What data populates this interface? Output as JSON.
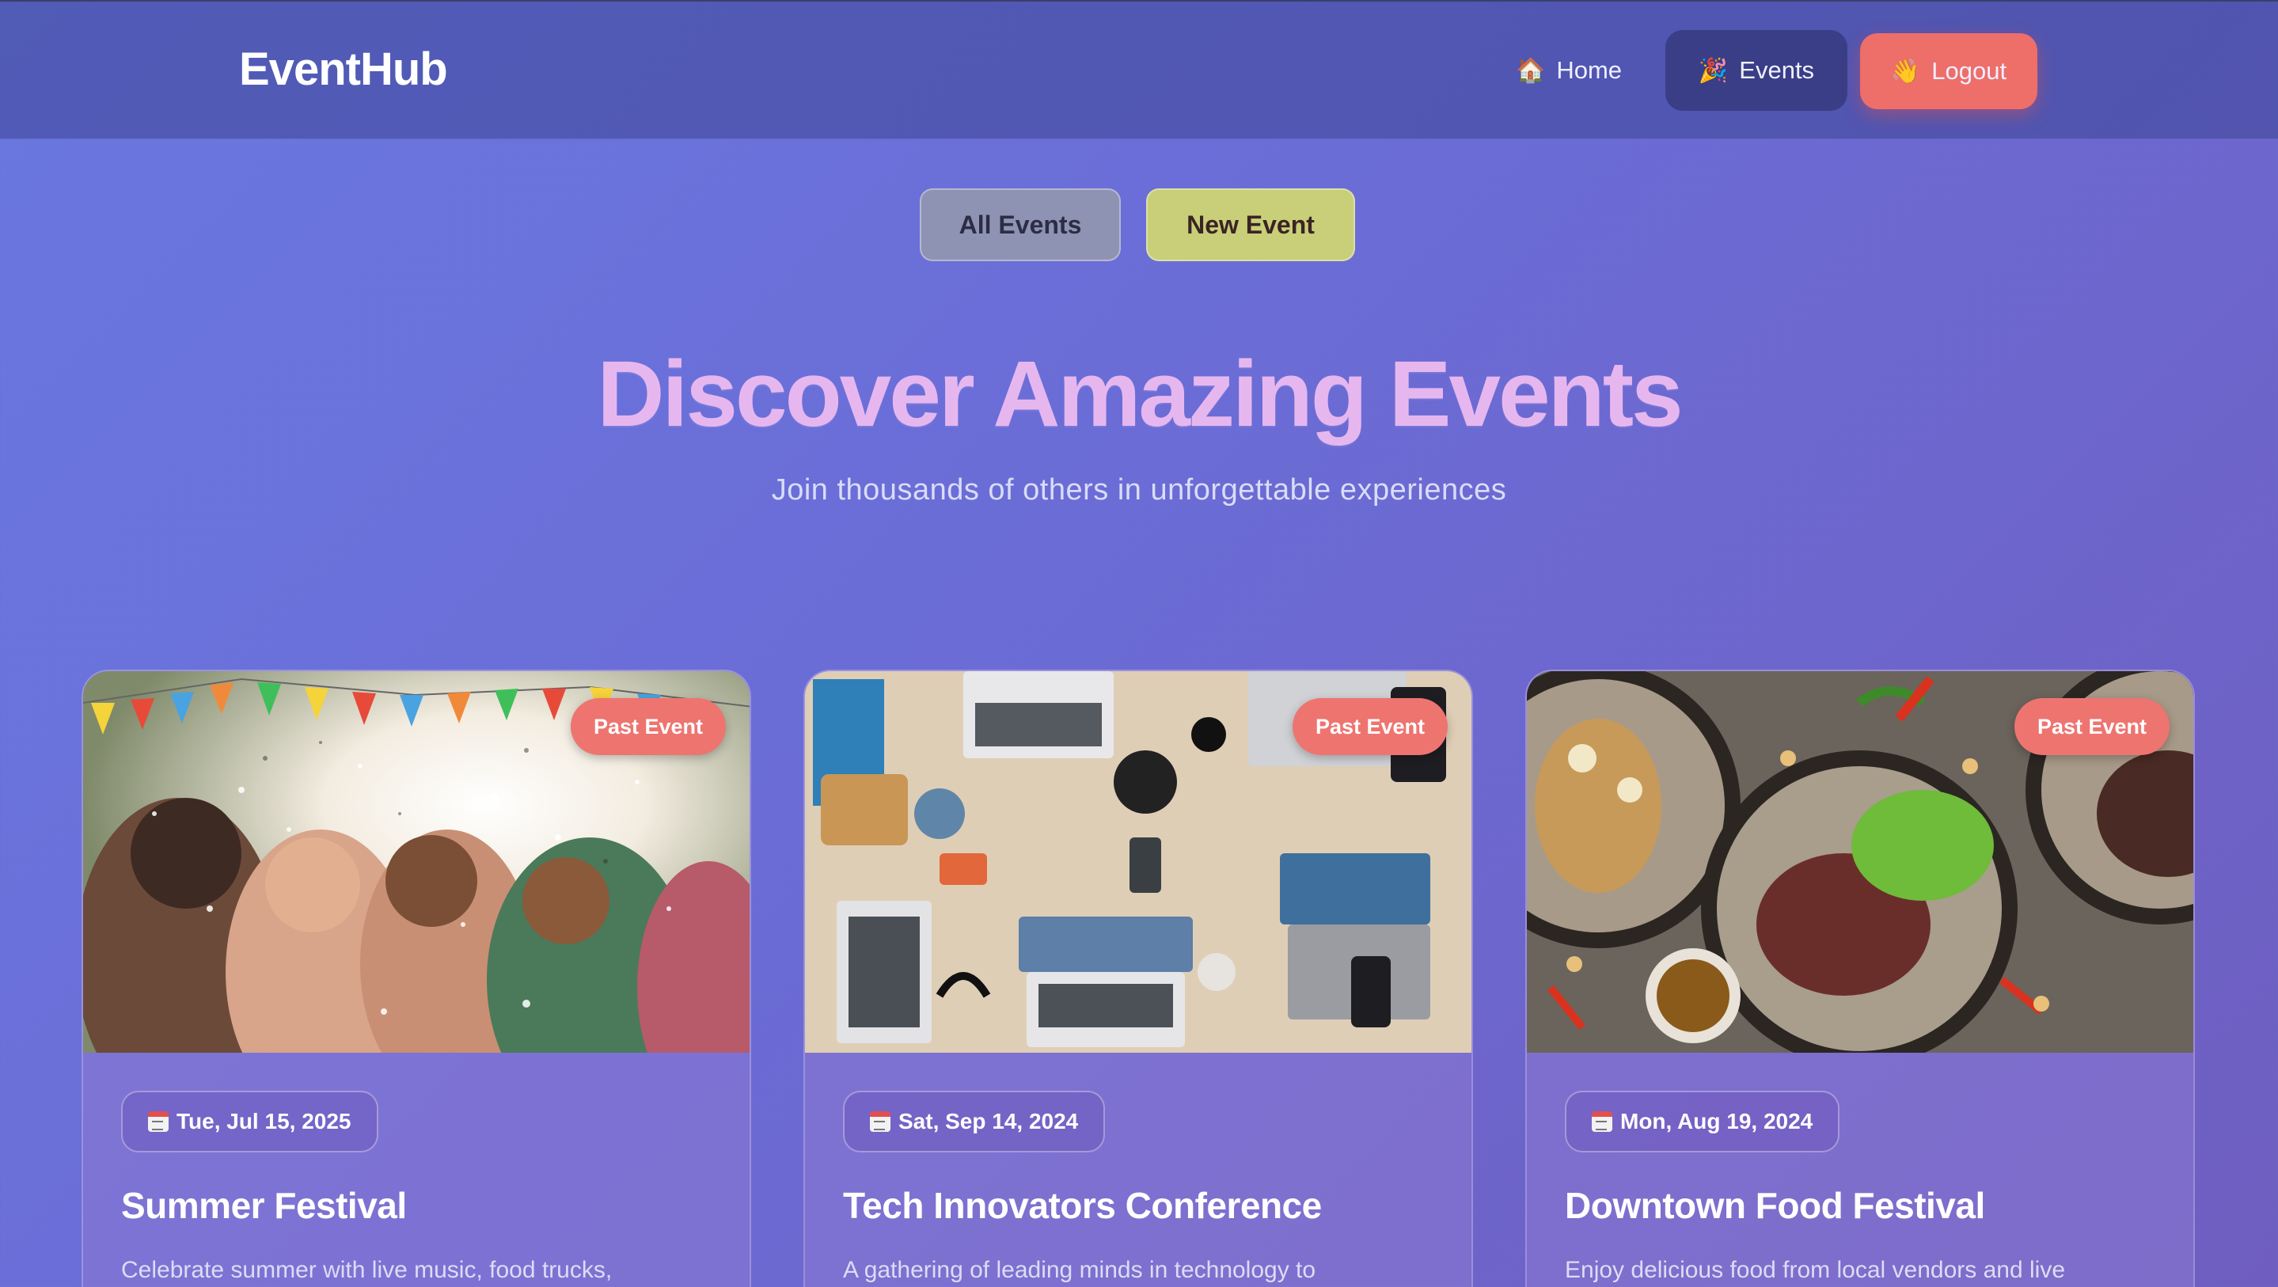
{
  "navbar": {
    "brand": "EventHub",
    "links": [
      {
        "label": "Home",
        "icon": "🏠"
      },
      {
        "label": "Events",
        "icon": "🎉"
      },
      {
        "label": "Logout",
        "icon": "👋"
      }
    ]
  },
  "filters": {
    "all_label": "All Events",
    "new_label": "New Event"
  },
  "hero": {
    "title": "Discover Amazing Events",
    "subtitle": "Join thousands of others in unforgettable experiences"
  },
  "events": [
    {
      "badge": "Past Event",
      "date": "Tue, Jul 15, 2025",
      "title": "Summer Festival",
      "description": "Celebrate summer with live music, food trucks,"
    },
    {
      "badge": "Past Event",
      "date": "Sat, Sep 14, 2024",
      "title": "Tech Innovators Conference",
      "description": "A gathering of leading minds in technology to"
    },
    {
      "badge": "Past Event",
      "date": "Mon, Aug 19, 2024",
      "title": "Downtown Food Festival",
      "description": "Enjoy delicious food from local vendors and live"
    }
  ],
  "colors": {
    "accent_logout": "#ee6e6a",
    "badge_past": "#ee7470",
    "hero_title": "#e6b7ef",
    "new_event_button": "#c9cf78"
  }
}
